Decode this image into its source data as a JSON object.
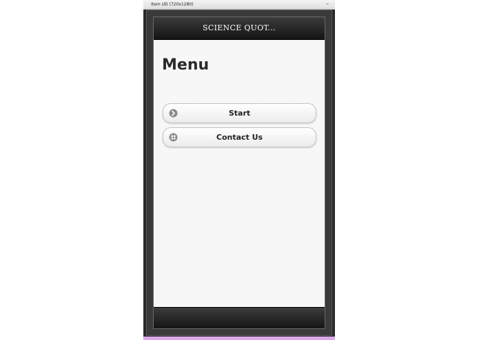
{
  "window": {
    "title": "Item UD (720x1280)",
    "minimize_glyph": "–"
  },
  "app": {
    "header_title": "SCIENCE QUOT..."
  },
  "menu": {
    "heading": "Menu",
    "items": [
      {
        "label": "Start",
        "icon": "arrow-right-circle-icon"
      },
      {
        "label": "Contact Us",
        "icon": "grid-icon"
      }
    ]
  },
  "colors": {
    "header_bg": "#1f1f1f",
    "screen_bg": "#f7f7f7",
    "accent_strip": "#d8a8e8"
  }
}
